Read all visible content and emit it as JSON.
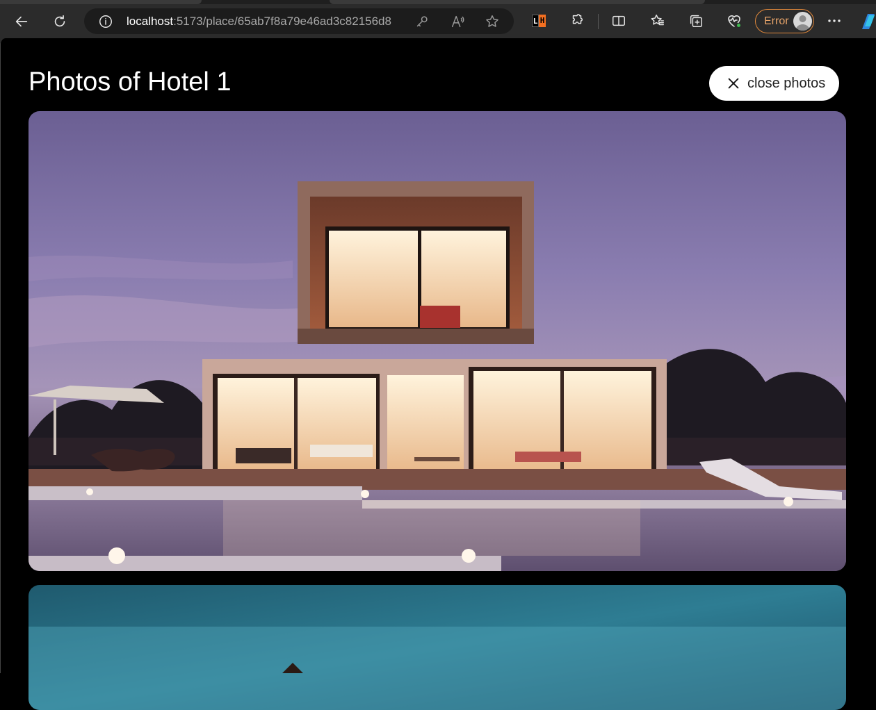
{
  "browser": {
    "address": {
      "host": "localhost",
      "path": ":5173/place/65ab7f8a79e46ad3c82156d8"
    },
    "extension_badge": {
      "left": "L",
      "right": "H"
    },
    "profile_status": "Error"
  },
  "gallery": {
    "title": "Photos of Hotel 1",
    "close_label": "close photos",
    "photos": [
      {
        "subject": "modern two-storey villa with pool at dusk"
      },
      {
        "subject": "teal sky photo (partially visible)"
      }
    ]
  },
  "colors": {
    "page_bg": "#000000",
    "chrome_bg": "#2b2b2b",
    "error_accent": "#e1883b",
    "close_button_bg": "#ffffff"
  },
  "icons": [
    "back-icon",
    "refresh-icon",
    "info-icon",
    "key-icon",
    "read-aloud-icon",
    "favorite-star-icon",
    "extensions-icon",
    "split-screen-icon",
    "favorites-icon",
    "collections-icon",
    "browser-essentials-icon",
    "more-icon",
    "copilot-icon",
    "close-icon"
  ]
}
